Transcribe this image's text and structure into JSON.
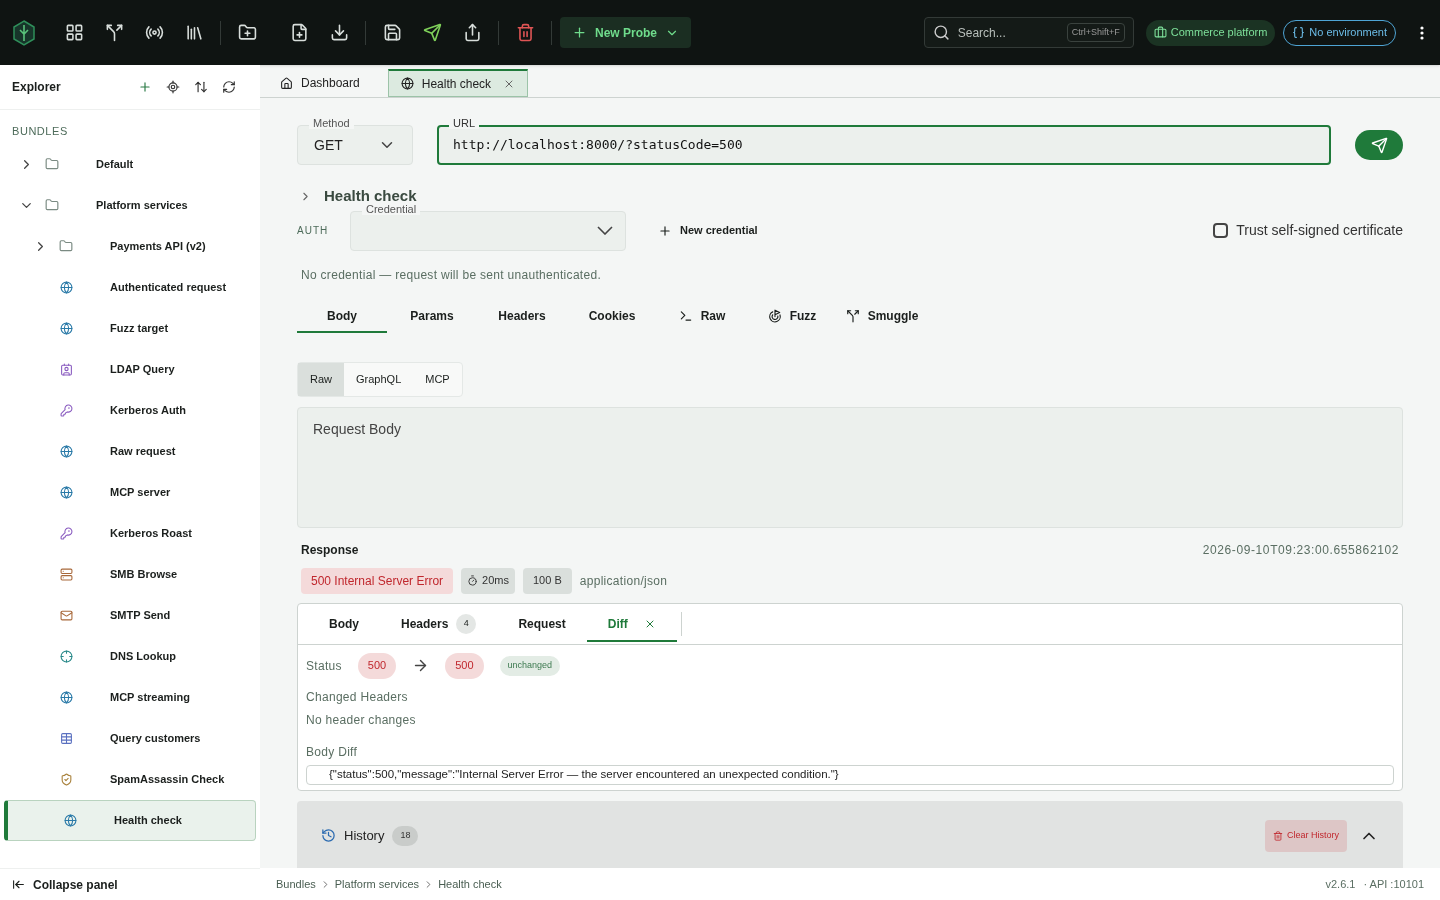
{
  "toolbar": {
    "new_probe": "New Probe",
    "search": {
      "placeholder": "Search...",
      "shortcut": "Ctrl+Shift+F"
    },
    "project": "Commerce platform",
    "environment": "No environment"
  },
  "explorer": {
    "title": "Explorer",
    "section": "BUNDLES",
    "items": [
      {
        "label": "Default",
        "kind": "folder",
        "expanded": false,
        "selected": false
      },
      {
        "label": "Platform services",
        "kind": "folder",
        "expanded": true,
        "selected": false,
        "children": [
          {
            "label": "Payments API (v2)",
            "kind": "folder",
            "expanded": false,
            "selected": false
          },
          {
            "label": "Authenticated request",
            "kind": "http",
            "selected": false
          },
          {
            "label": "Fuzz target",
            "kind": "http",
            "selected": false
          },
          {
            "label": "LDAP Query",
            "kind": "ldap",
            "selected": false
          },
          {
            "label": "Kerberos Auth",
            "kind": "kerberos",
            "selected": false
          },
          {
            "label": "Raw request",
            "kind": "http",
            "selected": false
          },
          {
            "label": "MCP server",
            "kind": "http",
            "selected": false
          },
          {
            "label": "Kerberos Roast",
            "kind": "kerberos",
            "selected": false
          },
          {
            "label": "SMB Browse",
            "kind": "smb",
            "selected": false
          },
          {
            "label": "SMTP Send",
            "kind": "smtp",
            "selected": false
          },
          {
            "label": "DNS Lookup",
            "kind": "dns",
            "selected": false
          },
          {
            "label": "MCP streaming",
            "kind": "http",
            "selected": false
          },
          {
            "label": "Query customers",
            "kind": "sql",
            "selected": false
          },
          {
            "label": "SpamAssassin Check",
            "kind": "spam",
            "selected": false
          },
          {
            "label": "Health check",
            "kind": "http",
            "selected": true
          }
        ]
      }
    ],
    "collapse": "Collapse panel"
  },
  "tabs": [
    {
      "label": "Dashboard",
      "kind": "home",
      "selected": false
    },
    {
      "label": "Health check",
      "kind": "http",
      "selected": true
    }
  ],
  "request": {
    "method_label": "Method",
    "method": "GET",
    "url_label": "URL",
    "url": "http://localhost:8000/?statusCode=500",
    "name": "Health check",
    "auth": {
      "label": "AUTH",
      "credential_label": "Credential",
      "new_credential": "New credential",
      "trust_label": "Trust self-signed certificate",
      "trust_checked": false,
      "note": "No credential — request will be sent unauthenticated."
    },
    "tabs": [
      {
        "label": "Body",
        "kind": "plain",
        "selected": true
      },
      {
        "label": "Params",
        "kind": "plain",
        "selected": false
      },
      {
        "label": "Headers",
        "kind": "plain",
        "selected": false
      },
      {
        "label": "Cookies",
        "kind": "plain",
        "selected": false
      },
      {
        "label": "Raw",
        "kind": "terminal",
        "selected": false
      },
      {
        "label": "Fuzz",
        "kind": "target",
        "selected": false
      },
      {
        "label": "Smuggle",
        "kind": "split",
        "selected": false
      }
    ],
    "body_modes": [
      {
        "label": "Raw",
        "selected": true
      },
      {
        "label": "GraphQL",
        "selected": false
      },
      {
        "label": "MCP",
        "selected": false
      }
    ],
    "body_placeholder": "Request Body"
  },
  "response": {
    "title": "Response",
    "timestamp": "2026-09-10T09:23:00.655862102",
    "status": "500 Internal Server Error",
    "time": "20ms",
    "size": "100 B",
    "content_type": "application/json",
    "tabs": [
      {
        "label": "Body",
        "selected": false
      },
      {
        "label": "Headers",
        "count": "4",
        "selected": false
      },
      {
        "label": "Request",
        "selected": false
      },
      {
        "label": "Diff",
        "closable": true,
        "selected": true
      }
    ],
    "diff": {
      "status_label": "Status",
      "from": "500",
      "to": "500",
      "change": "unchanged",
      "headers_title": "Changed Headers",
      "headers_note": "No header changes",
      "body_title": "Body Diff",
      "body_line": "{\"status\":500,\"message\":\"Internal Server Error — the server encountered an unexpected condition.\"}"
    }
  },
  "history": {
    "title": "History",
    "count": "18",
    "clear": "Clear History",
    "expanded": true
  },
  "breadcrumb": [
    "Bundles",
    "Platform services",
    "Health check"
  ],
  "version": "v2.6.1",
  "api": "· API :10101"
}
